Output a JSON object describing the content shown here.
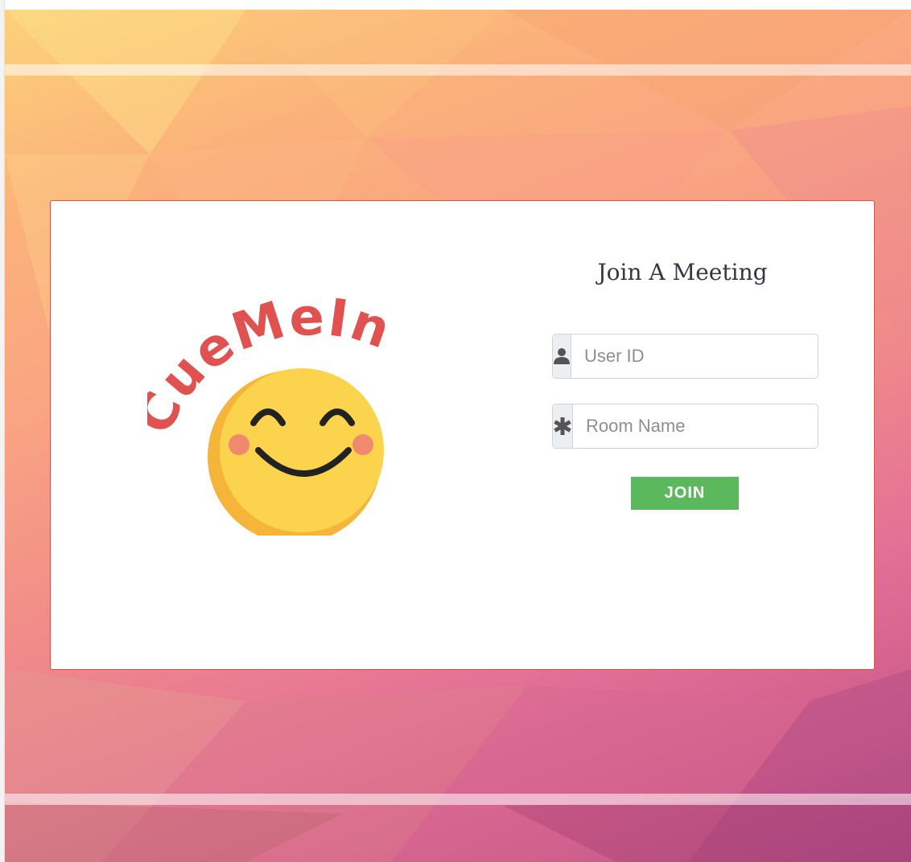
{
  "app": {
    "logo_text": "CueMeIn"
  },
  "form": {
    "title": "Join A Meeting",
    "user_id_placeholder": "User ID",
    "user_id_value": "",
    "user_icon": "user-icon",
    "room_name_placeholder": "Room Name",
    "room_name_value": "",
    "room_icon": "asterisk-icon",
    "join_label": "JOIN"
  },
  "colors": {
    "card_border": "#d9534f",
    "join_button": "#5cb85c",
    "logo_text": "#e0524f",
    "smiley_face": "#fcd34d"
  }
}
